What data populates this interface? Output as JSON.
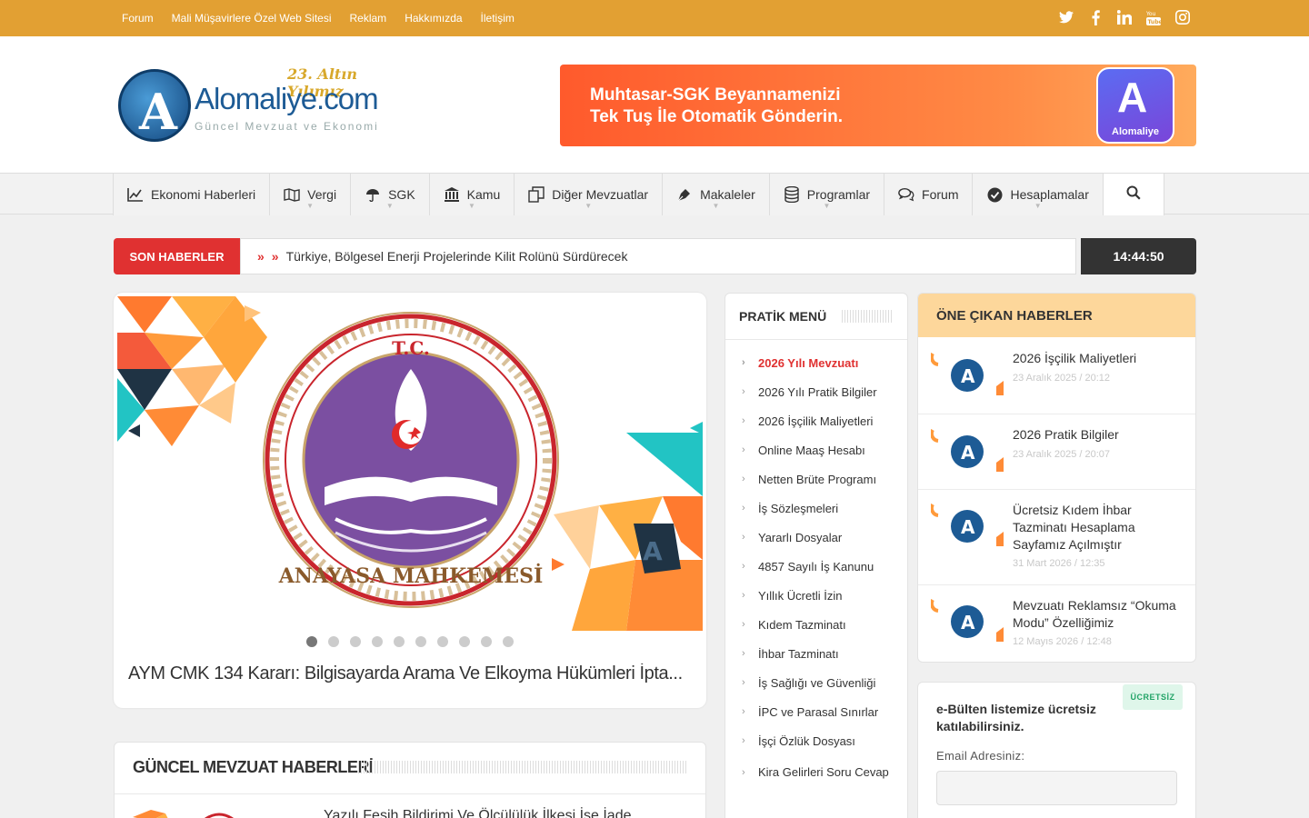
{
  "topnav": [
    "Forum",
    "Mali Müşavirlere Özel Web Sitesi",
    "Reklam",
    "Hakkımızda",
    "İletişim"
  ],
  "social": [
    "twitter-icon",
    "facebook-icon",
    "linkedin-icon",
    "youtube-icon",
    "instagram-icon"
  ],
  "logo": {
    "name": "Alomaliye.com",
    "tagline": "Güncel Mevzuat ve Ekonomi",
    "badge": "23. Altın Yılımız"
  },
  "banner": {
    "line1": "Muhtasar-SGK Beyannamenizi",
    "line2": "Tek Tuş İle Otomatik Gönderin.",
    "app_label": "Alomaliye"
  },
  "mainnav": [
    {
      "label": "Ekonomi Haberleri",
      "icon": "chart-icon",
      "has_sub": false
    },
    {
      "label": "Vergi",
      "icon": "book-icon",
      "has_sub": true
    },
    {
      "label": "SGK",
      "icon": "umbrella-icon",
      "has_sub": true
    },
    {
      "label": "Kamu",
      "icon": "bank-icon",
      "has_sub": true
    },
    {
      "label": "Diğer Mevzuatlar",
      "icon": "copy-icon",
      "has_sub": true
    },
    {
      "label": "Makaleler",
      "icon": "pen-icon",
      "has_sub": true
    },
    {
      "label": "Programlar",
      "icon": "database-icon",
      "has_sub": true
    },
    {
      "label": "Forum",
      "icon": "comments-icon",
      "has_sub": false
    },
    {
      "label": "Hesaplamalar",
      "icon": "check-circle-icon",
      "has_sub": true
    }
  ],
  "ticker": {
    "label": "SON HABERLER",
    "headline": "Türkiye, Bölgesel Enerji Projelerinde Kilit Rolünü Sürdürecek",
    "clock": "14:44:50"
  },
  "slider": {
    "image_top": "T.C.",
    "image_bottom": "ANAYASA MAHKEMESİ",
    "title": "AYM CMK 134 Kararı: Bilgisayarda Arama Ve Elkoyma Hükümleri İpta...",
    "dot_count": 10,
    "active_dot": 1
  },
  "gundem": {
    "heading": "GÜNCEL MEVZUAT HABERLERİ",
    "first_item": "Yazılı Fesih Bildirimi Ve Ölçülülük İlkesi İşe İade"
  },
  "pratik": {
    "heading": "PRATİK MENÜ",
    "items": [
      "2026 Yılı Mevzuatı",
      "2026 Yılı Pratik Bilgiler",
      "2026 İşçilik Maliyetleri",
      "Online Maaş Hesabı",
      "Netten Brüte Programı",
      "İş Sözleşmeleri",
      "Yararlı Dosyalar",
      "4857 Sayılı İş Kanunu",
      "Yıllık Ücretli İzin",
      "Kıdem Tazminatı",
      "İhbar Tazminatı",
      "İş Sağlığı ve Güvenliği",
      "İPC ve Parasal Sınırlar",
      "İşçi Özlük Dosyası",
      "Kira Gelirleri Soru Cevap"
    ]
  },
  "featured": {
    "heading": "ÖNE ÇIKAN HABERLER",
    "items": [
      {
        "title": "2026 İşçilik Maliyetleri",
        "date": "23 Aralık 2025 / 20:12"
      },
      {
        "title": "2026 Pratik Bilgiler",
        "date": "23 Aralık 2025 / 20:07"
      },
      {
        "title": "Ücretsiz Kıdem İhbar Tazminatı Hesaplama Sayfamız Açılmıştır",
        "date": "31 Mart 2026 / 12:35"
      },
      {
        "title": "Mevzuatı Reklamsız “Okuma Modu” Özelliğimiz",
        "date": "12 Mayıs 2026 / 12:48"
      }
    ]
  },
  "ebulten": {
    "badge": "ÜCRETSİZ",
    "text": "e-Bülten listemize ücretsiz katılabilirsiniz.",
    "email_label": "Email Adresiniz:",
    "email_value": ""
  },
  "colors": {
    "topbar": "#e2a033",
    "accent_red": "#e03131",
    "featured_head": "#fdd79b",
    "clock_bg": "#333333"
  }
}
